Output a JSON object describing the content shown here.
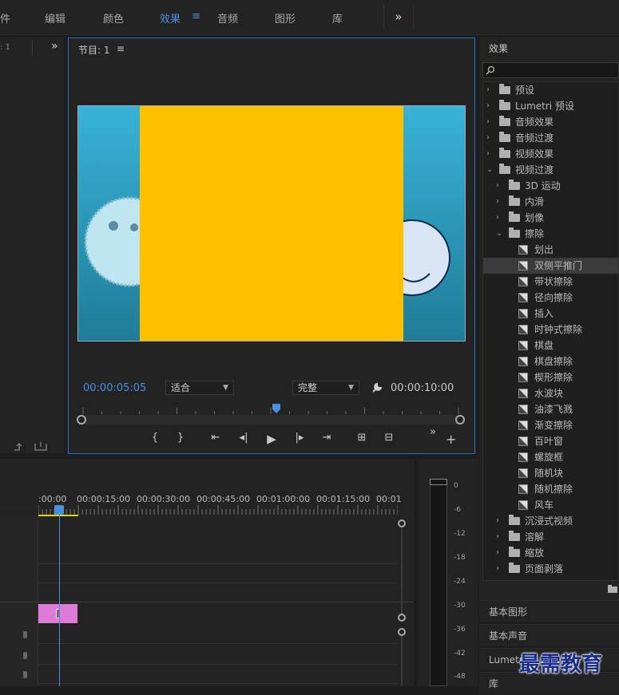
{
  "topbar": {
    "tabs": [
      "件",
      "编辑",
      "颜色",
      "效果",
      "音频",
      "图形",
      "库"
    ],
    "menu_glyph": "≡",
    "more": "»"
  },
  "source": {
    "label": ": 1",
    "more": "»"
  },
  "program": {
    "title": "节目: 1",
    "menu_glyph": "≡",
    "current_time": "00:00:05:05",
    "fit": "适合",
    "quality": "完整",
    "duration": "00:00:10:00",
    "controls": [
      "{",
      "}",
      "⇤",
      "◂|",
      "▶",
      "|▸",
      "⇥",
      "⊞",
      "⊟"
    ],
    "more": "»",
    "add": "+"
  },
  "effects": {
    "title": "效果",
    "items": [
      {
        "label": "预设",
        "kind": "folder-star",
        "level": 0,
        "open": false
      },
      {
        "label": "Lumetri 预设",
        "kind": "folder-star",
        "level": 0,
        "open": false
      },
      {
        "label": "音频效果",
        "kind": "folder",
        "level": 0,
        "open": false
      },
      {
        "label": "音频过渡",
        "kind": "folder",
        "level": 0,
        "open": false
      },
      {
        "label": "视频效果",
        "kind": "folder",
        "level": 0,
        "open": false
      },
      {
        "label": "视频过渡",
        "kind": "folder",
        "level": 0,
        "open": true
      },
      {
        "label": "3D 运动",
        "kind": "folder",
        "level": 1,
        "open": false
      },
      {
        "label": "内滑",
        "kind": "folder",
        "level": 1,
        "open": false
      },
      {
        "label": "划像",
        "kind": "folder",
        "level": 1,
        "open": false
      },
      {
        "label": "擦除",
        "kind": "folder",
        "level": 1,
        "open": true
      },
      {
        "label": "划出",
        "kind": "fx",
        "level": 2
      },
      {
        "label": "双侧平推门",
        "kind": "fx",
        "level": 2,
        "selected": true
      },
      {
        "label": "带状擦除",
        "kind": "fx",
        "level": 2
      },
      {
        "label": "径向擦除",
        "kind": "fx",
        "level": 2
      },
      {
        "label": "插入",
        "kind": "fx",
        "level": 2
      },
      {
        "label": "时钟式擦除",
        "kind": "fx",
        "level": 2
      },
      {
        "label": "棋盘",
        "kind": "fx",
        "level": 2
      },
      {
        "label": "棋盘擦除",
        "kind": "fx",
        "level": 2
      },
      {
        "label": "楔形擦除",
        "kind": "fx",
        "level": 2
      },
      {
        "label": "水波块",
        "kind": "fx",
        "level": 2
      },
      {
        "label": "油漆飞溅",
        "kind": "fx",
        "level": 2
      },
      {
        "label": "渐变擦除",
        "kind": "fx",
        "level": 2
      },
      {
        "label": "百叶窗",
        "kind": "fx",
        "level": 2
      },
      {
        "label": "螺旋框",
        "kind": "fx",
        "level": 2
      },
      {
        "label": "随机块",
        "kind": "fx",
        "level": 2
      },
      {
        "label": "随机擦除",
        "kind": "fx",
        "level": 2
      },
      {
        "label": "风车",
        "kind": "fx",
        "level": 2
      },
      {
        "label": "沉浸式视频",
        "kind": "folder",
        "level": 1,
        "open": false
      },
      {
        "label": "溶解",
        "kind": "folder",
        "level": 1,
        "open": false
      },
      {
        "label": "缩放",
        "kind": "folder",
        "level": 1,
        "open": false
      },
      {
        "label": "页面剥落",
        "kind": "folder",
        "level": 1,
        "open": false
      }
    ]
  },
  "side_tabs": [
    "基本图形",
    "基本声音",
    "Lumetri",
    "库"
  ],
  "timeline": {
    "time_labels": [
      ":00:00",
      "00:00:15:00",
      "00:00:30:00",
      "00:00:45:00",
      "00:01:00:00",
      "00:01:15:00",
      "00:01"
    ]
  },
  "meter": {
    "db_labels": [
      "0",
      "-6",
      "-12",
      "-18",
      "-24",
      "-30",
      "-36",
      "-42",
      "-48"
    ]
  },
  "watermark": "最需教育",
  "colors": {
    "accent": "#4a90e2",
    "overlay": "#ffc000",
    "clip": "#e07ad8"
  }
}
